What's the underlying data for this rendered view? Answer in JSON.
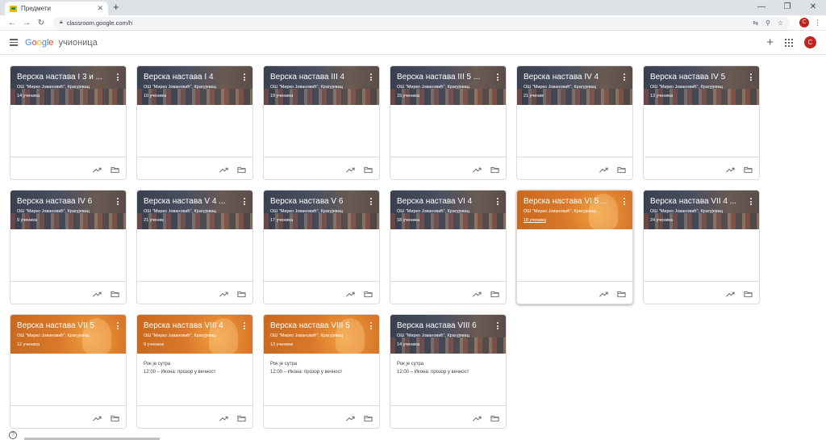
{
  "browser": {
    "tab_title": "Предмети",
    "tab_close": "✕",
    "new_tab": "+",
    "url": "classroom.google.com/h",
    "profile_initial": "C"
  },
  "app": {
    "logo_parts": [
      "G",
      "o",
      "o",
      "g",
      "l",
      "e"
    ],
    "product": "учионица",
    "add": "+",
    "avatar_initial": "C"
  },
  "courses": [
    {
      "title": "Верска настава I 3 и ...",
      "school": "ОШ \"Мирко Јовановић\", Крагујевац",
      "students": "14 ученика",
      "theme": "dark",
      "notice": "",
      "notice_item": ""
    },
    {
      "title": "Верска настава I 4",
      "school": "ОШ \"Мирко Јовановић\", Крагујевац",
      "students": "10 ученика",
      "theme": "dark",
      "notice": "",
      "notice_item": ""
    },
    {
      "title": "Верска настава III 4",
      "school": "ОШ \"Мирко Јовановић\", Крагујевац",
      "students": "19 ученика",
      "theme": "dark",
      "notice": "",
      "notice_item": ""
    },
    {
      "title": "Верска настава III 5 ...",
      "school": "ОШ \"Мирко Јовановић\", Крагујевац",
      "students": "15 ученика",
      "theme": "dark",
      "notice": "",
      "notice_item": ""
    },
    {
      "title": "Верска настава IV 4",
      "school": "ОШ \"Мирко Јовановић\", Крагујевац",
      "students": "21 ученик",
      "theme": "dark",
      "notice": "",
      "notice_item": ""
    },
    {
      "title": "Верска настава IV 5",
      "school": "ОШ \"Мирко Јовановић\", Крагујевац",
      "students": "13 ученика",
      "theme": "dark",
      "notice": "",
      "notice_item": ""
    },
    {
      "title": "Верска настава IV 6",
      "school": "ОШ \"Мирко Јовановић\", Крагујевац",
      "students": "9 ученика",
      "theme": "dark",
      "notice": "",
      "notice_item": ""
    },
    {
      "title": "Верска настава V 4 ...",
      "school": "ОШ \"Мирко Јовановић\", Крагујевац",
      "students": "21 ученик",
      "theme": "dark",
      "notice": "",
      "notice_item": ""
    },
    {
      "title": "Верска настава V 6",
      "school": "ОШ \"Мирко Јовановић\", Крагујевац",
      "students": "17 ученика",
      "theme": "dark",
      "notice": "",
      "notice_item": ""
    },
    {
      "title": "Верска настава VI 4",
      "school": "ОШ \"Мирко Јовановић\", Крагујевац",
      "students": "18 ученика",
      "theme": "dark",
      "notice": "",
      "notice_item": ""
    },
    {
      "title": "Верска настава VI 5 ...",
      "school": "ОШ \"Мирко Јовановић\", Крагујевац",
      "students": "18 ученика",
      "theme": "orange",
      "notice": "",
      "notice_item": ""
    },
    {
      "title": "Верска настава VII 4 ...",
      "school": "ОШ \"Мирко Јовановић\", Крагујевац",
      "students": "24 ученика",
      "theme": "dark",
      "notice": "",
      "notice_item": ""
    },
    {
      "title": "Верска настава VII 5",
      "school": "ОШ \"Мирко Јовановић\", Крагујевац",
      "students": "12 ученика",
      "theme": "orange",
      "notice": "",
      "notice_item": ""
    },
    {
      "title": "Верска настава VIII 4",
      "school": "ОШ \"Мирко Јовановић\", Крагујевац",
      "students": "9 ученика",
      "theme": "orange",
      "notice": "Рок је сутра",
      "notice_item": "12:00 – Икона: прозор у вечност"
    },
    {
      "title": "Верска настава VIII 5",
      "school": "ОШ \"Мирко Јовановић\", Крагујевац",
      "students": "13 ученика",
      "theme": "orange",
      "notice": "Рок је сутра",
      "notice_item": "12:00 – Икона: прозор у вечност"
    },
    {
      "title": "Верска настава VIII 6",
      "school": "ОШ \"Мирко Јовановић\", Крагујевац",
      "students": "14 ученика",
      "theme": "dark",
      "notice": "Рок је сутра",
      "notice_item": "12:00 – Икона: прозор у вечност"
    }
  ],
  "icons": {
    "trend": "trending-up-icon",
    "folder": "folder-icon",
    "help": "help-icon"
  },
  "help_label": "?"
}
